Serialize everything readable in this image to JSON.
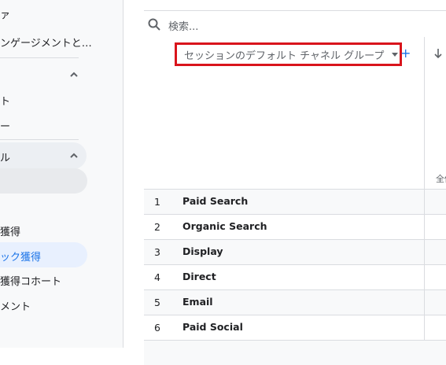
{
  "sidebar": {
    "items": [
      {
        "label": "ァ"
      },
      {
        "label": "ンゲージメントと…"
      },
      {
        "label": "ト"
      },
      {
        "label": "ー"
      },
      {
        "label": "ル"
      },
      {
        "label": "獲得"
      },
      {
        "label": "ック獲得"
      },
      {
        "label": "獲得コホート"
      },
      {
        "label": "メント"
      }
    ]
  },
  "search": {
    "placeholder": "検索..."
  },
  "table": {
    "dimension_label": "セッションのデフォルト チャネル グループ",
    "add_label": "+",
    "metric_partial": "全体",
    "rows": [
      {
        "index": "1",
        "label": "Paid Search"
      },
      {
        "index": "2",
        "label": "Organic Search"
      },
      {
        "index": "3",
        "label": "Display"
      },
      {
        "index": "4",
        "label": "Direct"
      },
      {
        "index": "5",
        "label": "Email"
      },
      {
        "index": "6",
        "label": "Paid Social"
      }
    ]
  },
  "colors": {
    "highlight_border": "#d9141c",
    "accent": "#1a73e8"
  }
}
